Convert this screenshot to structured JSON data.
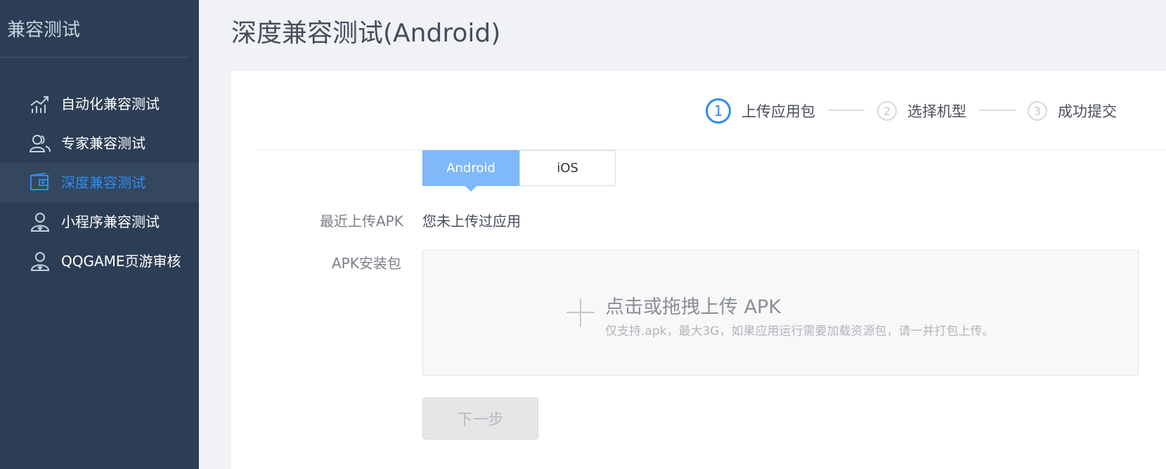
{
  "sidebar": {
    "title": "兼容测试",
    "items": [
      {
        "label": "自动化兼容测试",
        "icon": "chart-icon"
      },
      {
        "label": "专家兼容测试",
        "icon": "users-icon"
      },
      {
        "label": "深度兼容测试",
        "icon": "wallet-icon",
        "active": true
      },
      {
        "label": "小程序兼容测试",
        "icon": "user-download-icon"
      },
      {
        "label": "QQGAME页游审核",
        "icon": "user-download-icon"
      }
    ]
  },
  "page": {
    "title": "深度兼容测试(Android)"
  },
  "steps": [
    {
      "number": "1",
      "label": "上传应用包",
      "active": true
    },
    {
      "number": "2",
      "label": "选择机型",
      "active": false
    },
    {
      "number": "3",
      "label": "成功提交",
      "active": false
    }
  ],
  "tabs": [
    {
      "label": "Android",
      "selected": true
    },
    {
      "label": "iOS",
      "selected": false
    }
  ],
  "form": {
    "recent_label": "最近上传APK",
    "recent_value": "您未上传过应用",
    "package_label": "APK安装包"
  },
  "upload": {
    "title": "点击或拖拽上传 APK",
    "hint": "仅支持.apk，最大3G，如果应用运行需要加载资源包，请一并打包上传。"
  },
  "next_button": {
    "label": "下一步",
    "disabled": true
  },
  "colors": {
    "sidebar_bg": "#2c3e55",
    "accent": "#2d8cf0",
    "tab_selected": "#7fb9f9"
  }
}
